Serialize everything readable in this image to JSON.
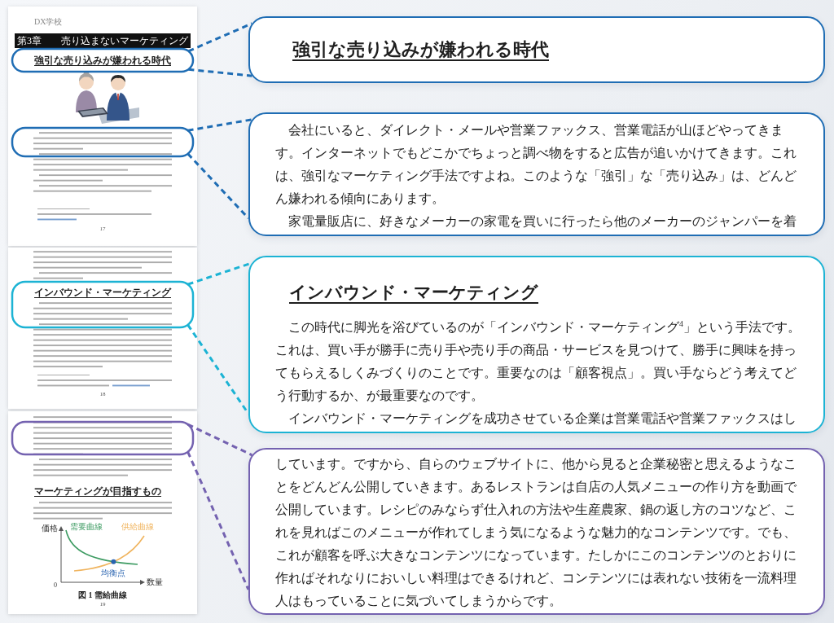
{
  "document": {
    "pages": [
      {
        "logo": "DX学校",
        "chapter_title": "第3章　　売り込まないマーケティング",
        "heading": "強引な売り込みが嫌われる時代",
        "page_number": "17"
      },
      {
        "heading": "インバウンド・マーケティング",
        "page_number": "18"
      },
      {
        "heading": "マーケティングが目指すもの",
        "figure": {
          "y_axis_label": "価格",
          "x_axis_label": "数量",
          "origin_label": "0",
          "curves": [
            {
              "kind": "falling",
              "label": "需要曲線",
              "color": "#3d9b62"
            },
            {
              "kind": "rising",
              "label": "供給曲線",
              "color": "#f0b45e"
            }
          ],
          "point_label": "均衡点",
          "caption": "図 1 需給曲線"
        },
        "page_number": "19"
      }
    ]
  },
  "callouts": [
    {
      "color": "#1f6db4",
      "heading": "強引な売り込みが嫌われる時代"
    },
    {
      "color": "#1f6db4",
      "paragraphs": [
        "　会社にいると、ダイレクト・メールや営業ファックス、営業電話が山ほどやってきます。インターネットでもどこかでちょっと調べ物をすると広告が追いかけてきます。これは、強引なマーケティング手法ですよね。このような「強引」な「売り込み」は、どんどん嫌われる傾向にあります。",
        "　家電量販店に、好きなメーカーの家電を買いに行ったら他のメーカーのジャンパーを着"
      ]
    },
    {
      "color": "#1cb3d4",
      "heading": "インバウンド・マーケティング",
      "paragraphs": [
        "　この時代に脚光を浴びているのが「インバウンド・マーケティング$^{4}$」という手法です。これは、買い手が勝手に売り手や売り手の商品・サービスを見つけて、勝手に興味を持ってもらえるしくみづくりのことです。重要なのは「顧客視点」。買い手ならどう考えてどう行動するか、が最重要なのです。",
        "　インバウンド・マーケティングを成功させている企業は営業電話や営業ファックスはし"
      ]
    },
    {
      "color": "#7462b0",
      "paragraphs": [
        "しています。ですから、自らのウェブサイトに、他から見ると企業秘密と思えるようなことをどんどん公開していきます。あるレストランは自店の人気メニューの作り方を動画で公開しています。レシピのみならず仕入れの方法や生産農家、鍋の返し方のコツなど、これを見ればこのメニューが作れてしまう気になるような魅力的なコンテンツです。でも、これが顧客を呼ぶ大きなコンテンツになっています。たしかにこのコンテンツのとおりに作ればそれなりにおいしい料理はできるけれど、コンテンツには表れない技術を一流料理人はもっていることに気づいてしまうからです。"
      ]
    }
  ]
}
